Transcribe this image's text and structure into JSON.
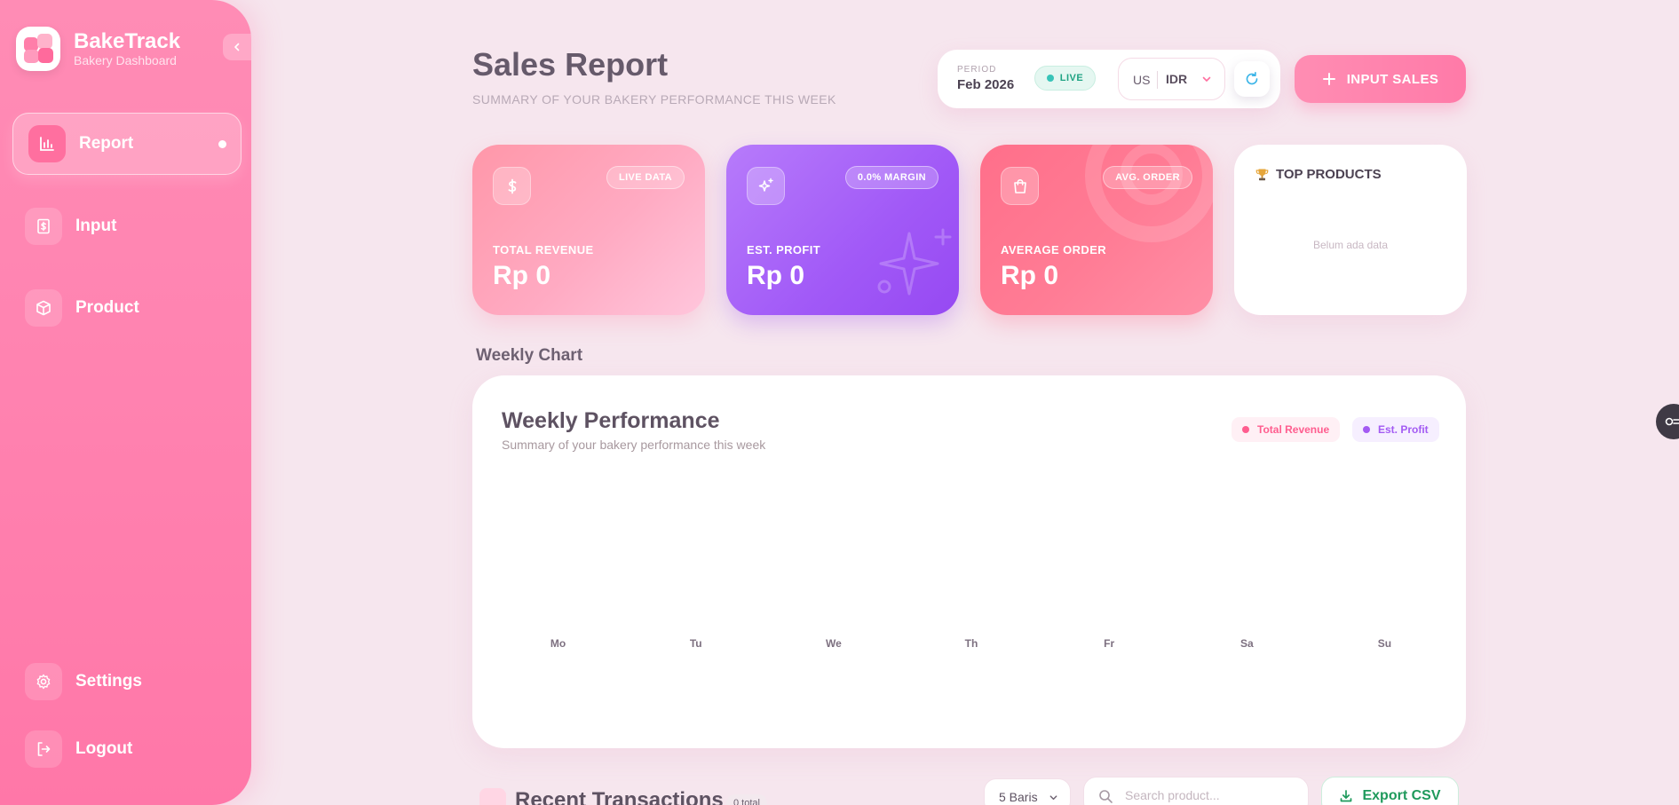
{
  "brand": {
    "title": "BakeTrack",
    "subtitle": "Bakery Dashboard"
  },
  "sidebar": {
    "items": [
      {
        "label": "Report",
        "icon": "bar-chart-icon",
        "active": true
      },
      {
        "label": "Input",
        "icon": "receipt-icon",
        "active": false
      },
      {
        "label": "Product",
        "icon": "box-icon",
        "active": false
      }
    ],
    "bottom": [
      {
        "label": "Settings",
        "icon": "gear-icon"
      },
      {
        "label": "Logout",
        "icon": "logout-icon"
      }
    ]
  },
  "header": {
    "title": "Sales Report",
    "subtitle": "SUMMARY OF YOUR BAKERY PERFORMANCE THIS WEEK",
    "period_label": "PERIOD",
    "period_value": "Feb 2026",
    "live_label": "LIVE",
    "currency_country": "US",
    "currency_code": "IDR",
    "input_sales_label": "INPUT SALES"
  },
  "stats": {
    "revenue": {
      "badge": "LIVE DATA",
      "label": "TOTAL REVENUE",
      "value": "Rp 0"
    },
    "profit": {
      "badge": "0.0% MARGIN",
      "label": "EST. PROFIT",
      "value": "Rp 0"
    },
    "order": {
      "badge": "AVG. ORDER",
      "label": "AVERAGE ORDER",
      "value": "Rp 0"
    },
    "top_products": {
      "title": "TOP PRODUCTS",
      "empty": "Belum ada data"
    }
  },
  "section_weekly": "Weekly Chart",
  "chart_data": {
    "type": "bar",
    "title": "Weekly Performance",
    "subtitle": "Summary of your bakery performance this week",
    "categories": [
      "Mo",
      "Tu",
      "We",
      "Th",
      "Fr",
      "Sa",
      "Su"
    ],
    "series": [
      {
        "name": "Total Revenue",
        "values": [
          0,
          0,
          0,
          0,
          0,
          0,
          0
        ],
        "color": "#ff5d8f"
      },
      {
        "name": "Est. Profit",
        "values": [
          0,
          0,
          0,
          0,
          0,
          0,
          0
        ],
        "color": "#a35bf3"
      }
    ],
    "legend": "top-right",
    "grid": false
  },
  "transactions": {
    "title": "Recent Transactions",
    "count": "0 total",
    "rows_label": "5 Baris",
    "search_placeholder": "Search product...",
    "export_label": "Export CSV"
  },
  "colors": {
    "sidebar": "#ff84b1",
    "revenue_card": "#ffaac2",
    "profit_card": "#a159f7",
    "order_card": "#ff7c95",
    "accent": "#ff7aa8"
  }
}
